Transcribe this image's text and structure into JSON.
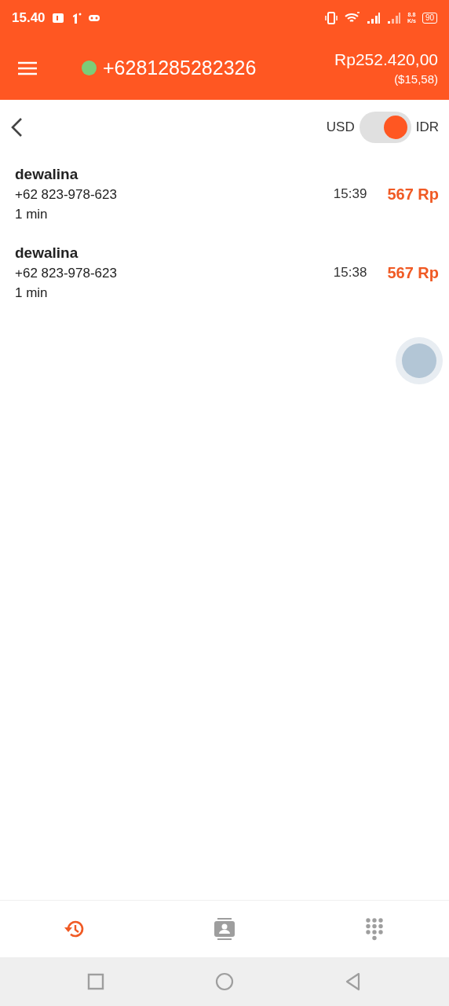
{
  "status_bar": {
    "time": "15.40",
    "speed": "8.8",
    "speed_unit": "K/s",
    "battery": "90"
  },
  "app_bar": {
    "phone": "+6281285282326",
    "online": true,
    "balance": "Rp252.420,00",
    "balance_usd": "($15,58)"
  },
  "currency_toggle": {
    "left": "USD",
    "right": "IDR",
    "on": true
  },
  "calls": [
    {
      "name": "dewalina",
      "number": "+62 823-978-623",
      "duration": "1 min",
      "time": "15:39",
      "cost": "567 Rp"
    },
    {
      "name": "dewalina",
      "number": "+62 823-978-623",
      "duration": "1 min",
      "time": "15:38",
      "cost": "567 Rp"
    }
  ],
  "bottom_tabs": [
    {
      "kind": "history",
      "selected": true
    },
    {
      "kind": "contacts",
      "selected": false
    },
    {
      "kind": "dialpad",
      "selected": false
    }
  ]
}
